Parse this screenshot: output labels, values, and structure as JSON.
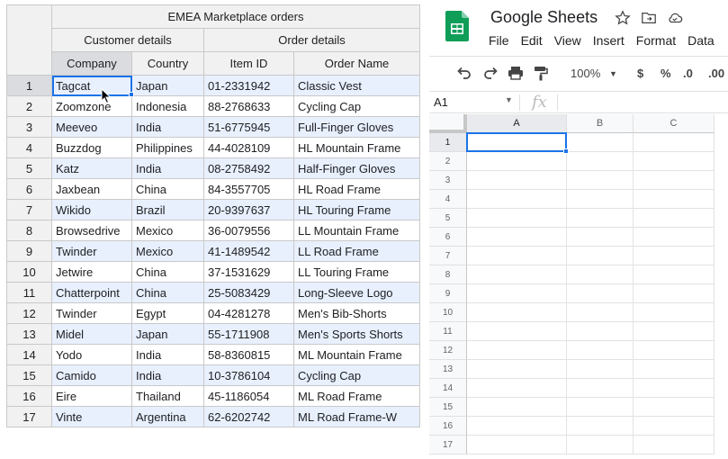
{
  "left_table": {
    "title": "EMEA Marketplace orders",
    "groups": [
      "Customer details",
      "Order details"
    ],
    "columns": [
      "Company",
      "Country",
      "Item ID",
      "Order Name"
    ],
    "rows": [
      {
        "num": "1",
        "cells": [
          "Tagcat",
          "Japan",
          "01-2331942",
          "Classic Vest"
        ]
      },
      {
        "num": "2",
        "cells": [
          "Zoomzone",
          "Indonesia",
          "88-2768633",
          "Cycling Cap"
        ]
      },
      {
        "num": "3",
        "cells": [
          "Meeveo",
          "India",
          "51-6775945",
          "Full-Finger Gloves"
        ]
      },
      {
        "num": "4",
        "cells": [
          "Buzzdog",
          "Philippines",
          "44-4028109",
          "HL Mountain Frame"
        ]
      },
      {
        "num": "5",
        "cells": [
          "Katz",
          "India",
          "08-2758492",
          "Half-Finger Gloves"
        ]
      },
      {
        "num": "6",
        "cells": [
          "Jaxbean",
          "China",
          "84-3557705",
          "HL Road Frame"
        ]
      },
      {
        "num": "7",
        "cells": [
          "Wikido",
          "Brazil",
          "20-9397637",
          "HL Touring Frame"
        ]
      },
      {
        "num": "8",
        "cells": [
          "Browsedrive",
          "Mexico",
          "36-0079556",
          "LL Mountain Frame"
        ]
      },
      {
        "num": "9",
        "cells": [
          "Twinder",
          "Mexico",
          "41-1489542",
          "LL Road Frame"
        ]
      },
      {
        "num": "10",
        "cells": [
          "Jetwire",
          "China",
          "37-1531629",
          "LL Touring Frame"
        ]
      },
      {
        "num": "11",
        "cells": [
          "Chatterpoint",
          "China",
          "25-5083429",
          "Long-Sleeve Logo"
        ]
      },
      {
        "num": "12",
        "cells": [
          "Twinder",
          "Egypt",
          "04-4281278",
          "Men's Bib-Shorts"
        ]
      },
      {
        "num": "13",
        "cells": [
          "Midel",
          "Japan",
          "55-1711908",
          "Men's Sports Shorts"
        ]
      },
      {
        "num": "14",
        "cells": [
          "Yodo",
          "India",
          "58-8360815",
          "ML Mountain Frame"
        ]
      },
      {
        "num": "15",
        "cells": [
          "Camido",
          "India",
          "10-3786104",
          "Cycling Cap"
        ]
      },
      {
        "num": "16",
        "cells": [
          "Eire",
          "Thailand",
          "45-1186054",
          "ML Road Frame"
        ]
      },
      {
        "num": "17",
        "cells": [
          "Vinte",
          "Argentina",
          "62-6202742",
          "ML Road Frame-W"
        ]
      }
    ]
  },
  "sheets": {
    "doc_title": "Google Sheets",
    "menu": [
      "File",
      "Edit",
      "View",
      "Insert",
      "Format",
      "Data"
    ],
    "toolbar": {
      "zoom": "100%",
      "currency": "$",
      "percent": "%",
      "decrease_decimal": ".0",
      "increase_decimal": ".00"
    },
    "name_box": "A1",
    "fx_label": "fx",
    "columns": [
      "A",
      "B",
      "C"
    ],
    "rows": [
      "1",
      "2",
      "3",
      "4",
      "5",
      "6",
      "7",
      "8",
      "9",
      "10",
      "11",
      "12",
      "13",
      "14",
      "15",
      "16",
      "17"
    ],
    "colors": {
      "accent": "#1a73e8",
      "logo": "#0f9d58"
    }
  },
  "icons": [
    "cursor-icon",
    "sheets-logo-icon",
    "star-icon",
    "move-folder-icon",
    "cloud-icon",
    "undo-icon",
    "redo-icon",
    "print-icon",
    "paint-format-icon",
    "dropdown-icon"
  ]
}
